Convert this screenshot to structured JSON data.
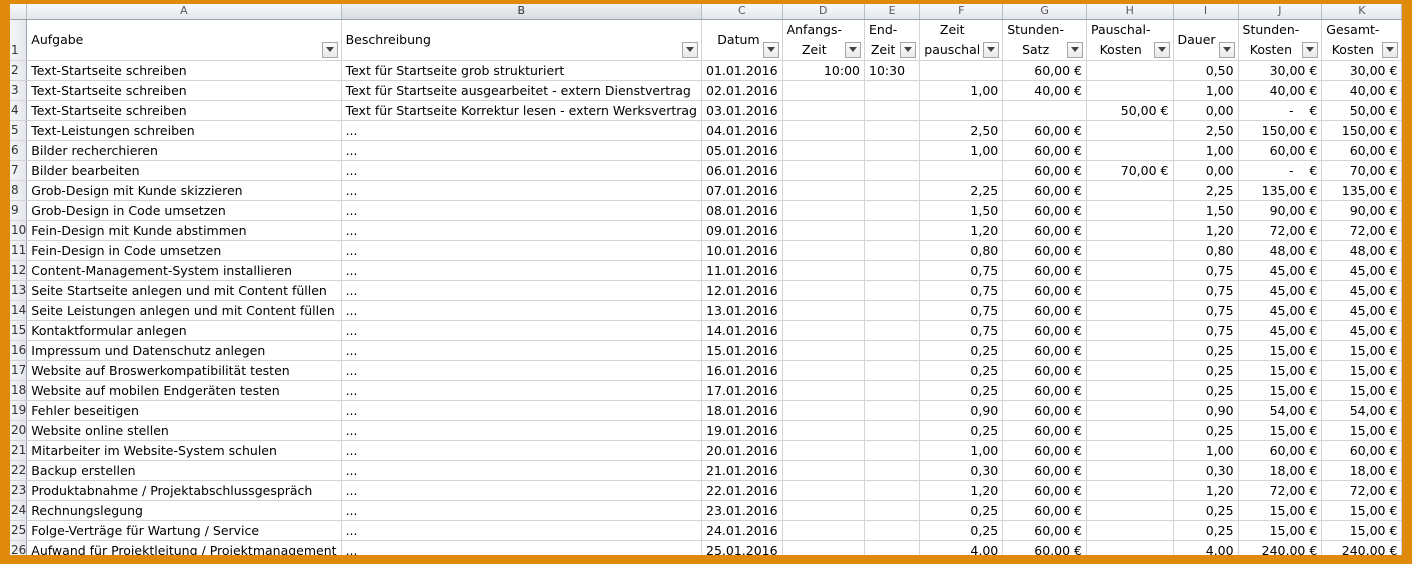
{
  "columns": [
    "A",
    "B",
    "C",
    "D",
    "E",
    "F",
    "G",
    "H",
    "I",
    "J",
    "K"
  ],
  "headers": {
    "A": [
      "Aufgabe"
    ],
    "B": [
      "Beschreibung"
    ],
    "C": [
      "Datum"
    ],
    "D": [
      "Anfangs-",
      "Zeit"
    ],
    "E": [
      "End-",
      "Zeit"
    ],
    "F": [
      "Zeit",
      "pauschal"
    ],
    "G": [
      "Stunden-",
      "Satz"
    ],
    "H": [
      "Pauschal-",
      "Kosten"
    ],
    "I": [
      "Dauer"
    ],
    "J": [
      "Stunden-",
      "Kosten"
    ],
    "K": [
      "Gesamt-",
      "Kosten"
    ]
  },
  "header_row_number": "1",
  "rows": [
    {
      "n": "2",
      "A": "Text-Startseite schreiben",
      "B": "Text für Startseite grob strukturiert",
      "C": "01.01.2016",
      "D": "10:00",
      "E": "10:30",
      "F": "",
      "G": "60,00 €",
      "H": "",
      "I": "0,50",
      "J": "30,00 €",
      "K": "30,00 €"
    },
    {
      "n": "3",
      "A": "Text-Startseite schreiben",
      "B": "Text für Startseite ausgearbeitet - extern Dienstvertrag",
      "C": "02.01.2016",
      "D": "",
      "E": "",
      "F": "1,00",
      "G": "40,00 €",
      "H": "",
      "I": "1,00",
      "J": "40,00 €",
      "K": "40,00 €"
    },
    {
      "n": "4",
      "A": "Text-Startseite schreiben",
      "B": "Text für Startseite Korrektur lesen - extern Werksvertrag",
      "C": "03.01.2016",
      "D": "",
      "E": "",
      "F": "",
      "G": "",
      "H": "50,00 €",
      "I": "0,00",
      "J": "-    €",
      "K": "50,00 €"
    },
    {
      "n": "5",
      "A": "Text-Leistungen schreiben",
      "B": "...",
      "C": "04.01.2016",
      "D": "",
      "E": "",
      "F": "2,50",
      "G": "60,00 €",
      "H": "",
      "I": "2,50",
      "J": "150,00 €",
      "K": "150,00 €"
    },
    {
      "n": "6",
      "A": "Bilder recherchieren",
      "B": "...",
      "C": "05.01.2016",
      "D": "",
      "E": "",
      "F": "1,00",
      "G": "60,00 €",
      "H": "",
      "I": "1,00",
      "J": "60,00 €",
      "K": "60,00 €"
    },
    {
      "n": "7",
      "A": "Bilder bearbeiten",
      "B": "...",
      "C": "06.01.2016",
      "D": "",
      "E": "",
      "F": "",
      "G": "60,00 €",
      "H": "70,00 €",
      "I": "0,00",
      "J": "-    €",
      "K": "70,00 €"
    },
    {
      "n": "8",
      "A": "Grob-Design mit Kunde skizzieren",
      "B": "...",
      "C": "07.01.2016",
      "D": "",
      "E": "",
      "F": "2,25",
      "G": "60,00 €",
      "H": "",
      "I": "2,25",
      "J": "135,00 €",
      "K": "135,00 €"
    },
    {
      "n": "9",
      "A": "Grob-Design in Code umsetzen",
      "B": "...",
      "C": "08.01.2016",
      "D": "",
      "E": "",
      "F": "1,50",
      "G": "60,00 €",
      "H": "",
      "I": "1,50",
      "J": "90,00 €",
      "K": "90,00 €"
    },
    {
      "n": "10",
      "A": "Fein-Design mit Kunde abstimmen",
      "B": "...",
      "C": "09.01.2016",
      "D": "",
      "E": "",
      "F": "1,20",
      "G": "60,00 €",
      "H": "",
      "I": "1,20",
      "J": "72,00 €",
      "K": "72,00 €"
    },
    {
      "n": "11",
      "A": "Fein-Design in Code umsetzen",
      "B": "...",
      "C": "10.01.2016",
      "D": "",
      "E": "",
      "F": "0,80",
      "G": "60,00 €",
      "H": "",
      "I": "0,80",
      "J": "48,00 €",
      "K": "48,00 €"
    },
    {
      "n": "12",
      "A": "Content-Management-System installieren",
      "B": "...",
      "C": "11.01.2016",
      "D": "",
      "E": "",
      "F": "0,75",
      "G": "60,00 €",
      "H": "",
      "I": "0,75",
      "J": "45,00 €",
      "K": "45,00 €"
    },
    {
      "n": "13",
      "A": "Seite Startseite anlegen und mit Content füllen",
      "B": "...",
      "C": "12.01.2016",
      "D": "",
      "E": "",
      "F": "0,75",
      "G": "60,00 €",
      "H": "",
      "I": "0,75",
      "J": "45,00 €",
      "K": "45,00 €"
    },
    {
      "n": "14",
      "A": "Seite Leistungen anlegen und mit Content füllen",
      "B": "...",
      "C": "13.01.2016",
      "D": "",
      "E": "",
      "F": "0,75",
      "G": "60,00 €",
      "H": "",
      "I": "0,75",
      "J": "45,00 €",
      "K": "45,00 €"
    },
    {
      "n": "15",
      "A": "Kontaktformular anlegen",
      "B": "...",
      "C": "14.01.2016",
      "D": "",
      "E": "",
      "F": "0,75",
      "G": "60,00 €",
      "H": "",
      "I": "0,75",
      "J": "45,00 €",
      "K": "45,00 €"
    },
    {
      "n": "16",
      "A": "Impressum und Datenschutz anlegen",
      "B": "...",
      "C": "15.01.2016",
      "D": "",
      "E": "",
      "F": "0,25",
      "G": "60,00 €",
      "H": "",
      "I": "0,25",
      "J": "15,00 €",
      "K": "15,00 €"
    },
    {
      "n": "17",
      "A": "Website auf Broswerkompatibilität testen",
      "B": "...",
      "C": "16.01.2016",
      "D": "",
      "E": "",
      "F": "0,25",
      "G": "60,00 €",
      "H": "",
      "I": "0,25",
      "J": "15,00 €",
      "K": "15,00 €"
    },
    {
      "n": "18",
      "A": "Website auf mobilen Endgeräten testen",
      "B": "...",
      "C": "17.01.2016",
      "D": "",
      "E": "",
      "F": "0,25",
      "G": "60,00 €",
      "H": "",
      "I": "0,25",
      "J": "15,00 €",
      "K": "15,00 €"
    },
    {
      "n": "19",
      "A": "Fehler beseitigen",
      "B": "...",
      "C": "18.01.2016",
      "D": "",
      "E": "",
      "F": "0,90",
      "G": "60,00 €",
      "H": "",
      "I": "0,90",
      "J": "54,00 €",
      "K": "54,00 €"
    },
    {
      "n": "20",
      "A": "Website online stellen",
      "B": "...",
      "C": "19.01.2016",
      "D": "",
      "E": "",
      "F": "0,25",
      "G": "60,00 €",
      "H": "",
      "I": "0,25",
      "J": "15,00 €",
      "K": "15,00 €"
    },
    {
      "n": "21",
      "A": "Mitarbeiter im Website-System schulen",
      "B": "...",
      "C": "20.01.2016",
      "D": "",
      "E": "",
      "F": "1,00",
      "G": "60,00 €",
      "H": "",
      "I": "1,00",
      "J": "60,00 €",
      "K": "60,00 €"
    },
    {
      "n": "22",
      "A": "Backup erstellen",
      "B": "...",
      "C": "21.01.2016",
      "D": "",
      "E": "",
      "F": "0,30",
      "G": "60,00 €",
      "H": "",
      "I": "0,30",
      "J": "18,00 €",
      "K": "18,00 €"
    },
    {
      "n": "23",
      "A": "Produktabnahme / Projektabschlussgespräch",
      "B": "...",
      "C": "22.01.2016",
      "D": "",
      "E": "",
      "F": "1,20",
      "G": "60,00 €",
      "H": "",
      "I": "1,20",
      "J": "72,00 €",
      "K": "72,00 €"
    },
    {
      "n": "24",
      "A": "Rechnungslegung",
      "B": "...",
      "C": "23.01.2016",
      "D": "",
      "E": "",
      "F": "0,25",
      "G": "60,00 €",
      "H": "",
      "I": "0,25",
      "J": "15,00 €",
      "K": "15,00 €"
    },
    {
      "n": "25",
      "A": "Folge-Verträge für Wartung / Service",
      "B": "...",
      "C": "24.01.2016",
      "D": "",
      "E": "",
      "F": "0,25",
      "G": "60,00 €",
      "H": "",
      "I": "0,25",
      "J": "15,00 €",
      "K": "15,00 €"
    },
    {
      "n": "26",
      "A": "Aufwand für Projektleitung / Projektmanagement",
      "B": "...",
      "C": "25.01.2016",
      "D": "",
      "E": "",
      "F": "4,00",
      "G": "60,00 €",
      "H": "",
      "I": "4,00",
      "J": "240,00 €",
      "K": "240,00 €"
    }
  ],
  "colors": {
    "frame": "#e08a0c",
    "header_bg": "#e4e7eb",
    "gridline": "#d4d4d4"
  }
}
